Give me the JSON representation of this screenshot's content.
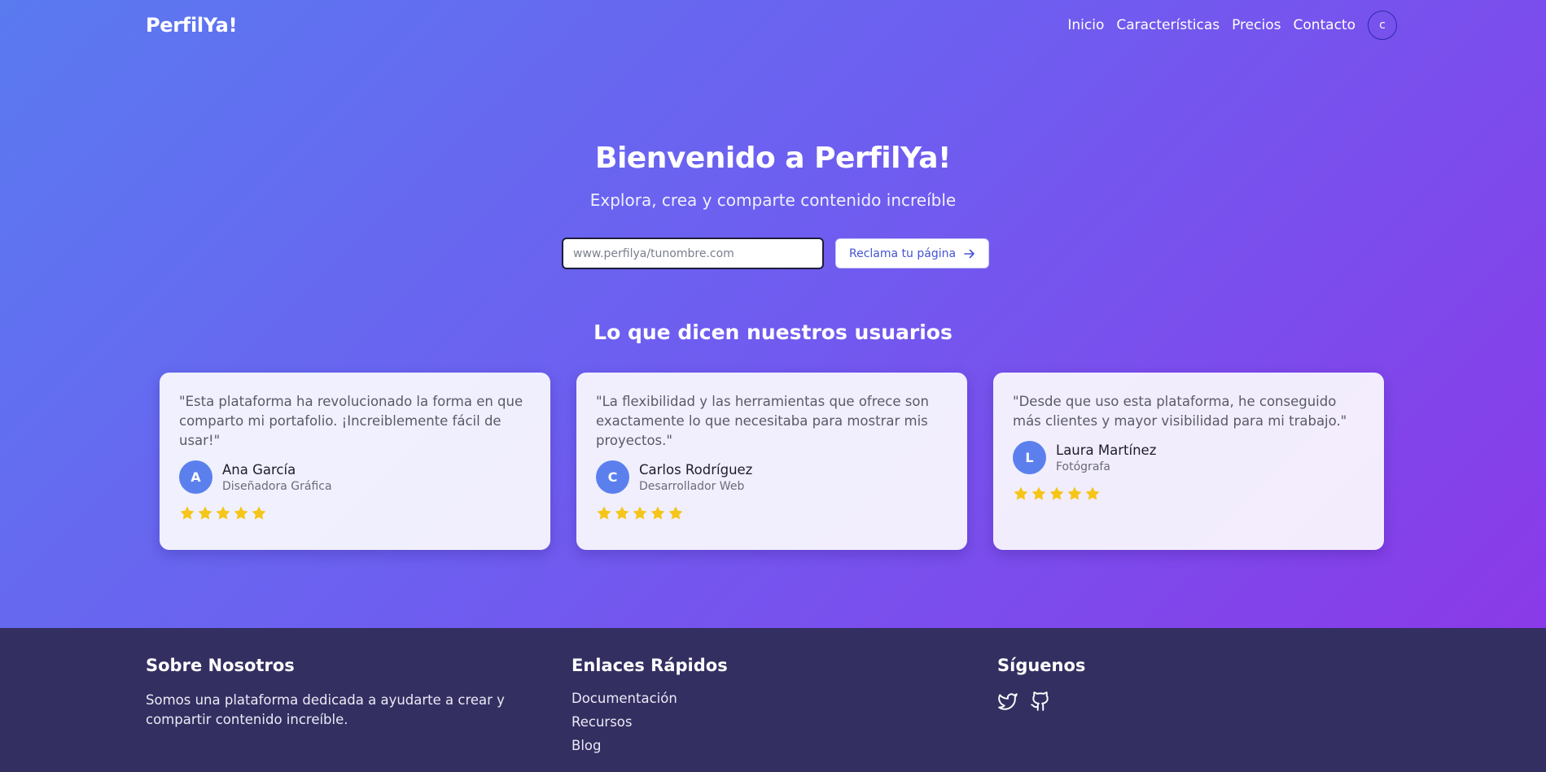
{
  "brand": "PerfilYa!",
  "nav": {
    "items": [
      "Inicio",
      "Características",
      "Precios",
      "Contacto"
    ],
    "avatar_letter": "c"
  },
  "hero": {
    "title": "Bienvenido a PerfilYa!",
    "subtitle": "Explora, crea y comparte contenido increíble",
    "input_placeholder": "www.perfilya/tunombre.com",
    "input_value": "",
    "claim_button": "Reclama tu página"
  },
  "testimonials": {
    "title": "Lo que dicen nuestros usuarios",
    "items": [
      {
        "quote": "\"Esta plataforma ha revolucionado la forma en que comparto mi portafolio. ¡Increiblemente fácil de usar!\"",
        "initial": "A",
        "name": "Ana García",
        "role": "Diseñadora Gráfica",
        "stars": 5
      },
      {
        "quote": "\"La flexibilidad y las herramientas que ofrece son exactamente lo que necesitaba para mostrar mis proyectos.\"",
        "initial": "C",
        "name": "Carlos Rodríguez",
        "role": "Desarrollador Web",
        "stars": 5
      },
      {
        "quote": "\"Desde que uso esta plataforma, he conseguido más clientes y mayor visibilidad para mi trabajo.\"",
        "initial": "L",
        "name": "Laura Martínez",
        "role": "Fotógrafa",
        "stars": 5
      }
    ]
  },
  "footer": {
    "about": {
      "title": "Sobre Nosotros",
      "text": "Somos una plataforma dedicada a ayudarte a crear y compartir contenido increíble."
    },
    "links": {
      "title": "Enlaces Rápidos",
      "items": [
        "Documentación",
        "Recursos",
        "Blog"
      ]
    },
    "social": {
      "title": "Síguenos",
      "icons": [
        "twitter-icon",
        "github-icon"
      ]
    }
  },
  "colors": {
    "hero_gradient_start": "#5a7af0",
    "hero_gradient_end": "#8a3ae8",
    "footer_bg": "#332f61",
    "accent": "#4453d8",
    "star": "#f5c518",
    "avatar": "#5b80ee"
  }
}
